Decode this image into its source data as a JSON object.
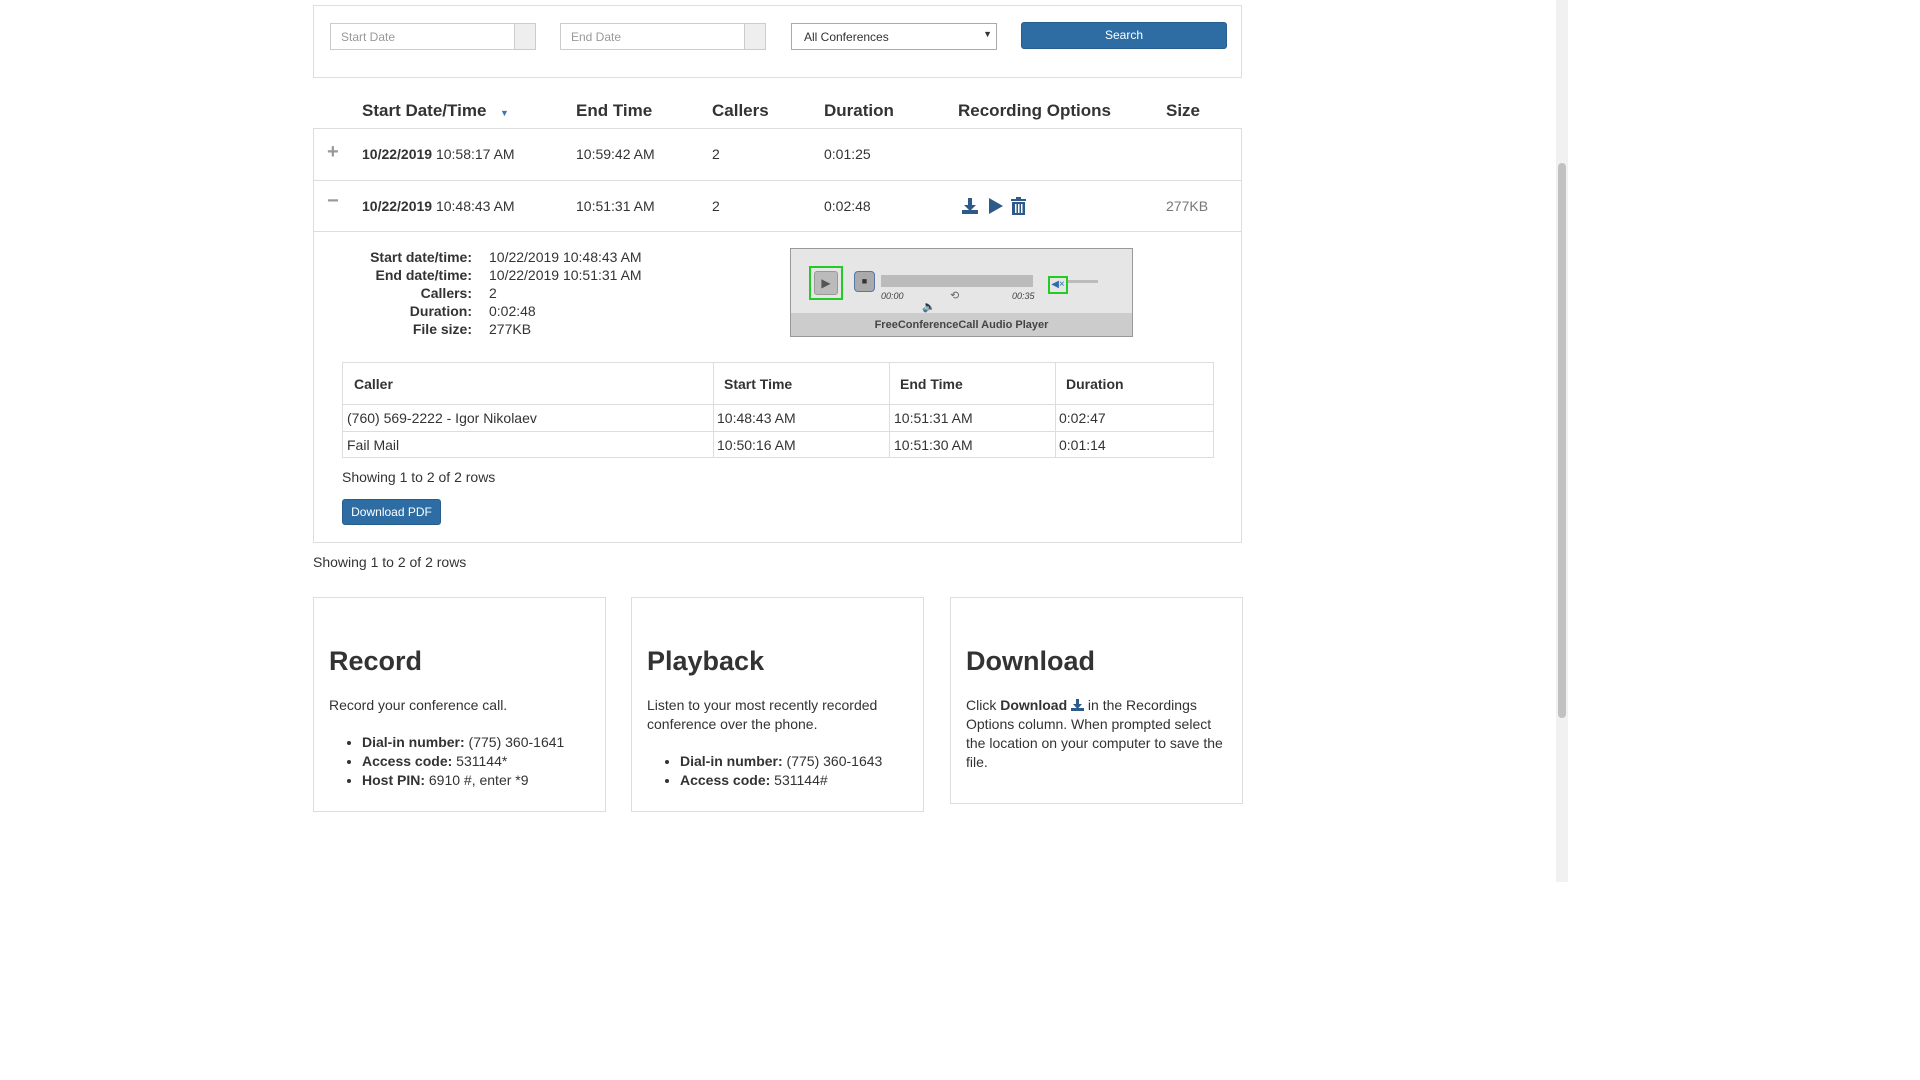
{
  "search": {
    "start_placeholder": "Start Date",
    "end_placeholder": "End Date",
    "conference_select": "All Conferences",
    "search_label": "Search"
  },
  "table": {
    "headers": [
      "Start Date/Time",
      "End Time",
      "Callers",
      "Duration",
      "Recording Options",
      "Size"
    ],
    "rows": [
      {
        "date": "10/22/2019",
        "time": "10:58:17 AM",
        "end": "10:59:42 AM",
        "callers": "2",
        "duration": "0:01:25",
        "size": ""
      },
      {
        "date": "10/22/2019",
        "time": "10:48:43 AM",
        "end": "10:51:31 AM",
        "callers": "2",
        "duration": "0:02:48",
        "size": "277KB"
      }
    ],
    "footer": "Showing 1 to 2 of 2 rows"
  },
  "detail": {
    "labels": {
      "start": "Start date/time:",
      "end": "End date/time:",
      "callers": "Callers:",
      "duration": "Duration:",
      "size": "File size:"
    },
    "values": {
      "start": "10/22/2019 10:48:43 AM",
      "end": "10/22/2019 10:51:31 AM",
      "callers": "2",
      "duration": "0:02:48",
      "size": "277KB"
    }
  },
  "player": {
    "time_current": "00:00",
    "time_total": "00:35",
    "caption": "FreeConferenceCall Audio Player"
  },
  "callers_table": {
    "headers": [
      "Caller",
      "Start Time",
      "End Time",
      "Duration"
    ],
    "rows": [
      [
        "(760) 569-2222 - Igor Nikolaev",
        "10:48:43 AM",
        "10:51:31 AM",
        "0:02:47"
      ],
      [
        "Fail Mail",
        "10:50:16 AM",
        "10:51:30 AM",
        "0:01:14"
      ]
    ],
    "footer": "Showing 1 to 2 of 2 rows",
    "download_pdf": "Download PDF"
  },
  "cards": {
    "record": {
      "title": "Record",
      "text": "Record your conference call.",
      "items": [
        {
          "label": "Dial-in number:",
          "value": " (775) 360-1641"
        },
        {
          "label": "Access code:",
          "value": " 531144*"
        },
        {
          "label": "Host PIN:",
          "value": " 6910 #, enter *9"
        }
      ]
    },
    "playback": {
      "title": "Playback",
      "text": "Listen to your most recently recorded conference over the phone.",
      "items": [
        {
          "label": "Dial-in number:",
          "value": " (775) 360-1643"
        },
        {
          "label": "Access code:",
          "value": " 531144#"
        }
      ]
    },
    "download": {
      "title": "Download",
      "text_pre": "Click ",
      "text_bold": "Download",
      "text_post": " in the Recordings Options column. When prompted select the location on your computer to save the file."
    }
  },
  "colors": {
    "primary": "#2e6da4",
    "border": "#dddddd",
    "highlight": "#22cc22"
  }
}
